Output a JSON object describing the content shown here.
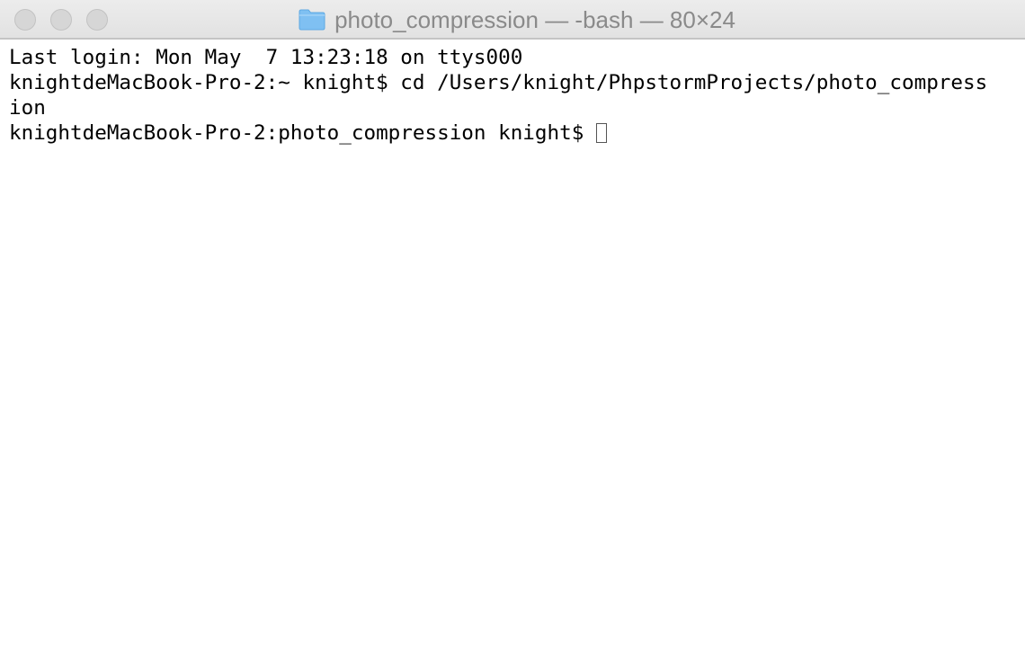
{
  "window": {
    "title": "photo_compression — -bash — 80×24",
    "folder_icon": "folder-icon"
  },
  "terminal": {
    "lines": [
      "Last login: Mon May  7 13:23:18 on ttys000",
      "knightdeMacBook-Pro-2:~ knight$ cd /Users/knight/PhpstormProjects/photo_compress",
      "ion",
      "knightdeMacBook-Pro-2:photo_compression knight$ "
    ]
  },
  "colors": {
    "title_text": "#8a8a8a",
    "folder_blue": "#7fc0f2",
    "terminal_text": "#000000",
    "background": "#ffffff"
  }
}
